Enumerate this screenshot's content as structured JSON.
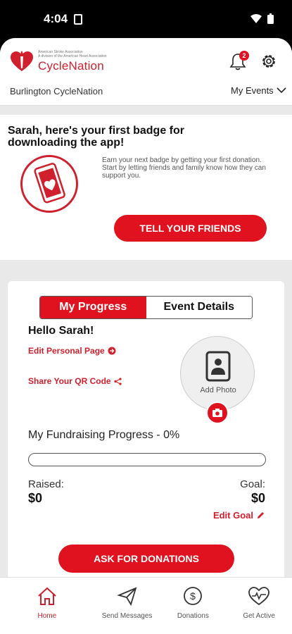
{
  "status": {
    "time": "4:04"
  },
  "header": {
    "org_small_line1": "American Stroke Association",
    "org_small_line2": "A division of the American Heart Association",
    "brand": "CycleNation",
    "event_name": "Burlington CycleNation",
    "notification_count": "2",
    "my_events_label": "My Events"
  },
  "badge_card": {
    "title": "Sarah, here's your first badge for downloading the app!",
    "description": "Earn your next badge by getting your first donation. Start by letting friends and family know how they can support you.",
    "button_label": "TELL YOUR FRIENDS"
  },
  "panel": {
    "tabs": [
      {
        "label": "My Progress",
        "active": true
      },
      {
        "label": "Event Details",
        "active": false
      }
    ],
    "greeting": "Hello Sarah!",
    "edit_page_label": "Edit Personal Page",
    "share_qr_label": "Share Your QR Code",
    "add_photo_label": "Add Photo",
    "fundraising_title": "My Fundraising Progress - 0%",
    "progress_fraction": 0,
    "raised_label": "Raised:",
    "raised_value": "$0",
    "goal_label": "Goal:",
    "goal_value": "$0",
    "edit_goal_label": "Edit Goal",
    "ask_button_label": "ASK FOR DONATIONS"
  },
  "nav": {
    "items": [
      {
        "label": "Home",
        "icon": "home-icon",
        "active": true
      },
      {
        "label": "Send Messages",
        "icon": "paper-plane-icon",
        "active": false
      },
      {
        "label": "Donations",
        "icon": "dollar-circle-icon",
        "active": false
      },
      {
        "label": "Get Active",
        "icon": "heart-pulse-icon",
        "active": false
      }
    ]
  },
  "colors": {
    "accent": "#e0121f",
    "brand_red": "#d0202e"
  }
}
